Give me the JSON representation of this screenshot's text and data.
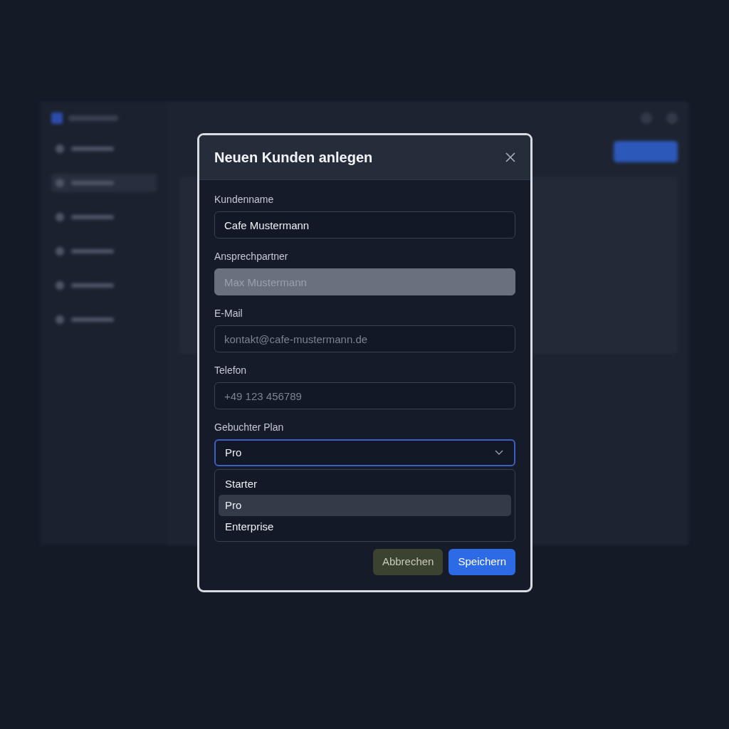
{
  "dialog": {
    "title": "Neuen Kunden anlegen",
    "fields": [
      {
        "kind": "text",
        "label": "Kundenname",
        "value": "Cafe Mustermann",
        "disabled": false
      },
      {
        "kind": "text",
        "label": "Ansprechpartner",
        "value": "Max Mustermann",
        "disabled": true
      },
      {
        "kind": "text",
        "label": "E-Mail",
        "placeholder": "kontakt@cafe-mustermann.de",
        "disabled": false
      },
      {
        "kind": "text",
        "label": "Telefon",
        "placeholder": "+49 123 456789",
        "disabled": false
      },
      {
        "kind": "select",
        "label": "Gebuchter Plan",
        "value": "Pro",
        "expanded": true,
        "options": [
          {
            "label": "Starter",
            "selected": false
          },
          {
            "label": "Pro",
            "selected": true
          },
          {
            "label": "Enterprise",
            "selected": false
          }
        ]
      }
    ],
    "buttons": [
      {
        "kind": "secondary",
        "label": "Abbrechen"
      },
      {
        "kind": "primary",
        "label": "Speichern"
      }
    ]
  }
}
